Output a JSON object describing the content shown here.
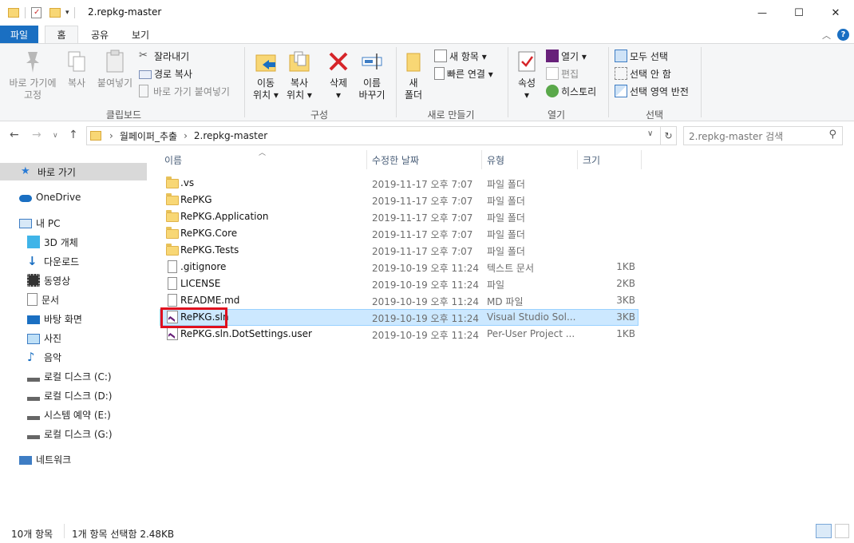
{
  "window": {
    "title": "2.repkg-master",
    "minimize_symbol": "—",
    "maximize_symbol": "☐",
    "close_symbol": "✕"
  },
  "ribbon_tabs": {
    "file": "파일",
    "home": "홈",
    "share": "공유",
    "view": "보기"
  },
  "ribbon": {
    "clipboard": {
      "label": "클립보드",
      "pin": [
        "바로 가기에",
        "고정"
      ],
      "copy": "복사",
      "paste": "붙여넣기",
      "cut": "잘라내기",
      "copy_path": "경로 복사",
      "paste_shortcut": "바로 가기 붙여넣기"
    },
    "organize": {
      "label": "구성",
      "move_to": [
        "이동",
        "위치 ▾"
      ],
      "copy_to": [
        "복사",
        "위치 ▾"
      ],
      "delete": [
        "삭제",
        "▾"
      ],
      "rename": [
        "이름",
        "바꾸기"
      ]
    },
    "new": {
      "label": "새로 만들기",
      "new_folder": [
        "새",
        "폴더"
      ],
      "new_item": "새 항목 ▾",
      "easy_access": "빠른 연결 ▾"
    },
    "open": {
      "label": "열기",
      "properties": [
        "속성",
        "▾"
      ],
      "open": "열기 ▾",
      "edit": "편집",
      "history": "히스토리"
    },
    "select": {
      "label": "선택",
      "select_all": "모두 선택",
      "select_none": "선택 안 함",
      "invert": "선택 영역 반전"
    }
  },
  "address": {
    "crumbs": [
      "월페이퍼_추출",
      "2.repkg-master"
    ],
    "separator": "›",
    "search_placeholder": "2.repkg-master 검색"
  },
  "nav_pane": [
    {
      "label": "바로 가기",
      "icon": "star-icon",
      "selected": true
    },
    {
      "label": "OneDrive",
      "icon": "cloud-icon"
    },
    {
      "label": "내 PC",
      "icon": "pc-icon"
    },
    {
      "label": "3D 개체",
      "icon": "cube-icon"
    },
    {
      "label": "다운로드",
      "icon": "download-icon"
    },
    {
      "label": "동영상",
      "icon": "video-icon"
    },
    {
      "label": "문서",
      "icon": "document-icon"
    },
    {
      "label": "바탕 화면",
      "icon": "desktop-icon"
    },
    {
      "label": "사진",
      "icon": "picture-icon"
    },
    {
      "label": "음악",
      "icon": "music-icon"
    },
    {
      "label": "로컬 디스크 (C:)",
      "icon": "drive-icon"
    },
    {
      "label": "로컬 디스크 (D:)",
      "icon": "drive-icon"
    },
    {
      "label": "시스템 예약 (E:)",
      "icon": "drive-icon"
    },
    {
      "label": "로컬 디스크 (G:)",
      "icon": "drive-icon"
    },
    {
      "label": "네트워크",
      "icon": "network-icon"
    }
  ],
  "columns": {
    "name": "이름",
    "date": "수정한 날짜",
    "type": "유형",
    "size": "크기"
  },
  "files": [
    {
      "name": ".vs",
      "date": "2019-11-17 오후 7:07",
      "type": "파일 폴더",
      "size": "",
      "kind": "folder"
    },
    {
      "name": "RePKG",
      "date": "2019-11-17 오후 7:07",
      "type": "파일 폴더",
      "size": "",
      "kind": "folder"
    },
    {
      "name": "RePKG.Application",
      "date": "2019-11-17 오후 7:07",
      "type": "파일 폴더",
      "size": "",
      "kind": "folder"
    },
    {
      "name": "RePKG.Core",
      "date": "2019-11-17 오후 7:07",
      "type": "파일 폴더",
      "size": "",
      "kind": "folder"
    },
    {
      "name": "RePKG.Tests",
      "date": "2019-11-17 오후 7:07",
      "type": "파일 폴더",
      "size": "",
      "kind": "folder"
    },
    {
      "name": ".gitignore",
      "date": "2019-10-19 오후 11:24",
      "type": "텍스트 문서",
      "size": "1KB",
      "kind": "text"
    },
    {
      "name": "LICENSE",
      "date": "2019-10-19 오후 11:24",
      "type": "파일",
      "size": "2KB",
      "kind": "file"
    },
    {
      "name": "README.md",
      "date": "2019-10-19 오후 11:24",
      "type": "MD 파일",
      "size": "3KB",
      "kind": "file"
    },
    {
      "name": "RePKG.sln",
      "date": "2019-10-19 오후 11:24",
      "type": "Visual Studio Sol...",
      "size": "3KB",
      "kind": "vs",
      "selected": true
    },
    {
      "name": "RePKG.sln.DotSettings.user",
      "date": "2019-10-19 오후 11:24",
      "type": "Per-User Project ...",
      "size": "1KB",
      "kind": "vs"
    }
  ],
  "status": {
    "count": "10개 항목",
    "selection": "1개 항목 선택함 2.48KB"
  },
  "colors": {
    "accent": "#1a6fc2",
    "selection": "#cce8ff",
    "highlight": "#e0101e"
  }
}
